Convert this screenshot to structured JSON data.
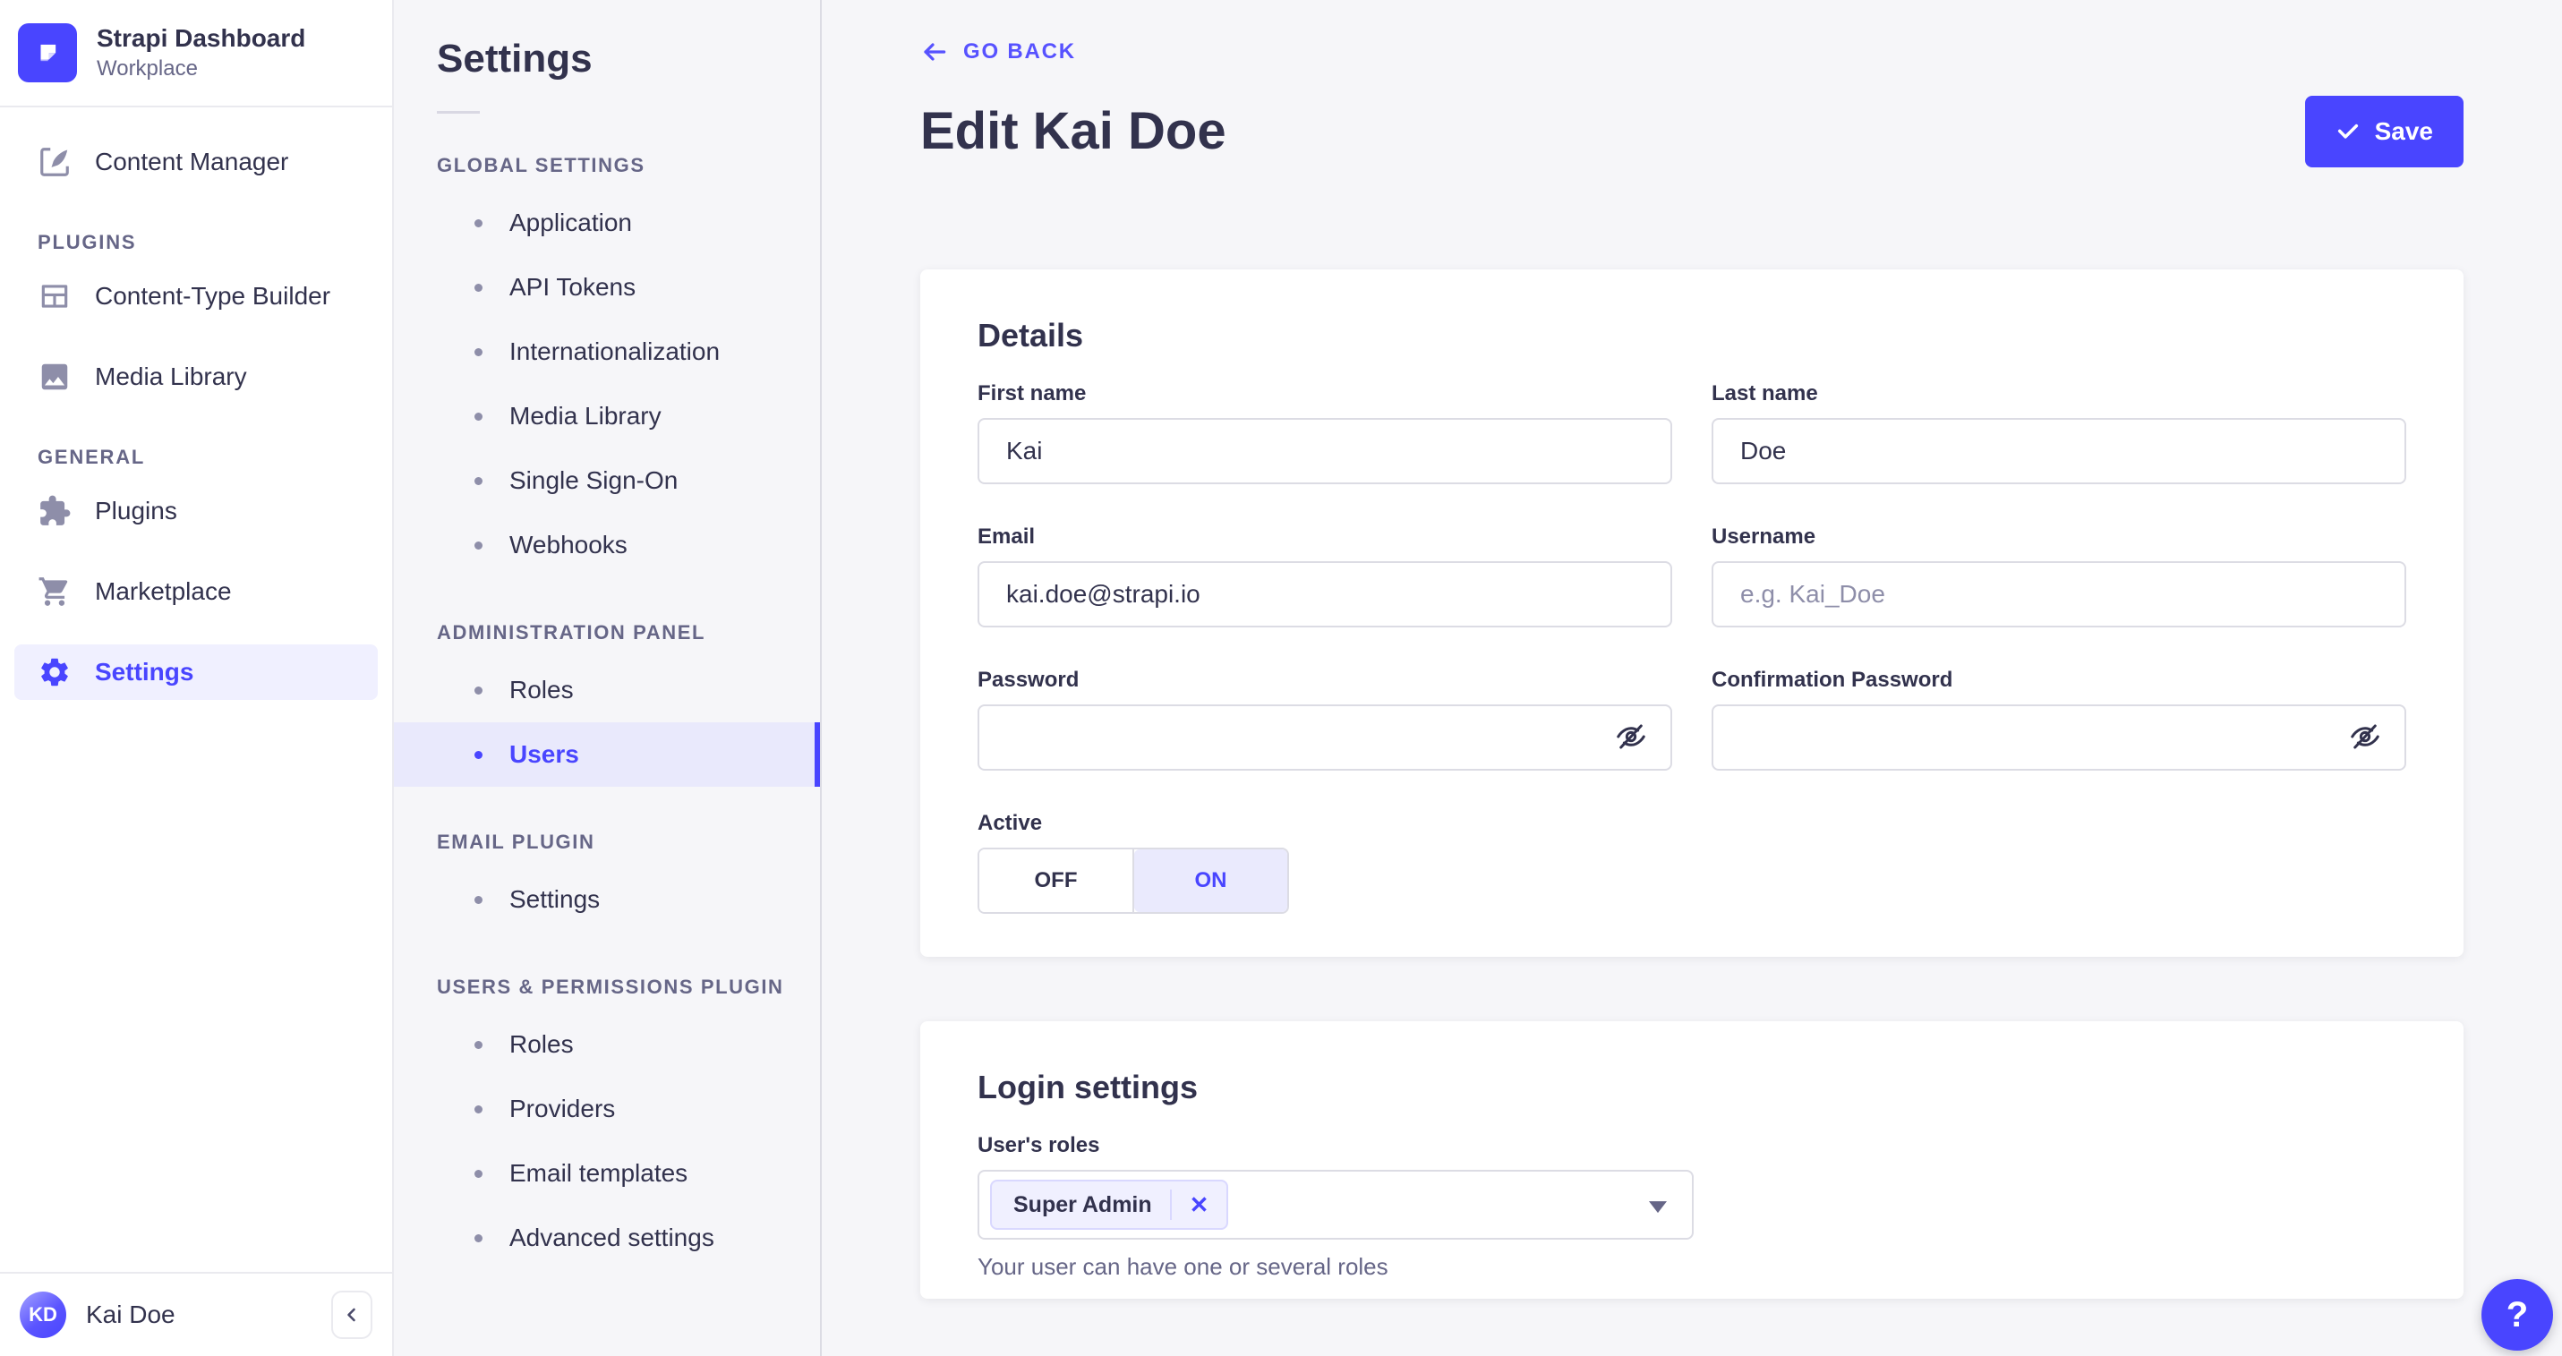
{
  "sidebar": {
    "app_name": "Strapi Dashboard",
    "workspace": "Workplace",
    "content_manager_label": "Content Manager",
    "sections": [
      {
        "label": "PLUGINS",
        "items": [
          "Content-Type Builder",
          "Media Library"
        ]
      },
      {
        "label": "GENERAL",
        "items": [
          "Plugins",
          "Marketplace",
          "Settings"
        ]
      }
    ],
    "user": {
      "initials": "KD",
      "name": "Kai Doe"
    }
  },
  "subnav": {
    "title": "Settings",
    "sections": [
      {
        "label": "GLOBAL SETTINGS",
        "items": [
          "Application",
          "API Tokens",
          "Internationalization",
          "Media Library",
          "Single Sign-On",
          "Webhooks"
        ]
      },
      {
        "label": "ADMINISTRATION PANEL",
        "items": [
          "Roles",
          "Users"
        ]
      },
      {
        "label": "EMAIL PLUGIN",
        "items": [
          "Settings"
        ]
      },
      {
        "label": "USERS & PERMISSIONS PLUGIN",
        "items": [
          "Roles",
          "Providers",
          "Email templates",
          "Advanced settings"
        ]
      }
    ],
    "active_item": "Users"
  },
  "header": {
    "back_label": "GO BACK",
    "title": "Edit Kai Doe",
    "save_label": "Save"
  },
  "details": {
    "title": "Details",
    "first_name": {
      "label": "First name",
      "value": "Kai"
    },
    "last_name": {
      "label": "Last name",
      "value": "Doe"
    },
    "email": {
      "label": "Email",
      "value": "kai.doe@strapi.io"
    },
    "username": {
      "label": "Username",
      "placeholder": "e.g. Kai_Doe"
    },
    "password": {
      "label": "Password"
    },
    "confirmation_password": {
      "label": "Confirmation Password"
    },
    "active": {
      "label": "Active",
      "off_label": "OFF",
      "on_label": "ON",
      "value": "ON"
    }
  },
  "login_settings": {
    "title": "Login settings",
    "roles_label": "User's roles",
    "selected_roles": [
      "Super Admin"
    ],
    "helper_text": "Your user can have one or several roles"
  },
  "help_button": {
    "label": "?"
  },
  "colors": {
    "primary": "#4945ff",
    "primary_light": "#eaeafd",
    "chip_bg": "#f0f0ff",
    "chip_border": "#d9d8ff",
    "text": "#32324d",
    "muted": "#666687",
    "placeholder": "#8e8ea9",
    "app_bg": "#f6f6f9",
    "card_bg": "#ffffff",
    "divider": "#eaeaef",
    "input_border": "#dcdce4"
  }
}
